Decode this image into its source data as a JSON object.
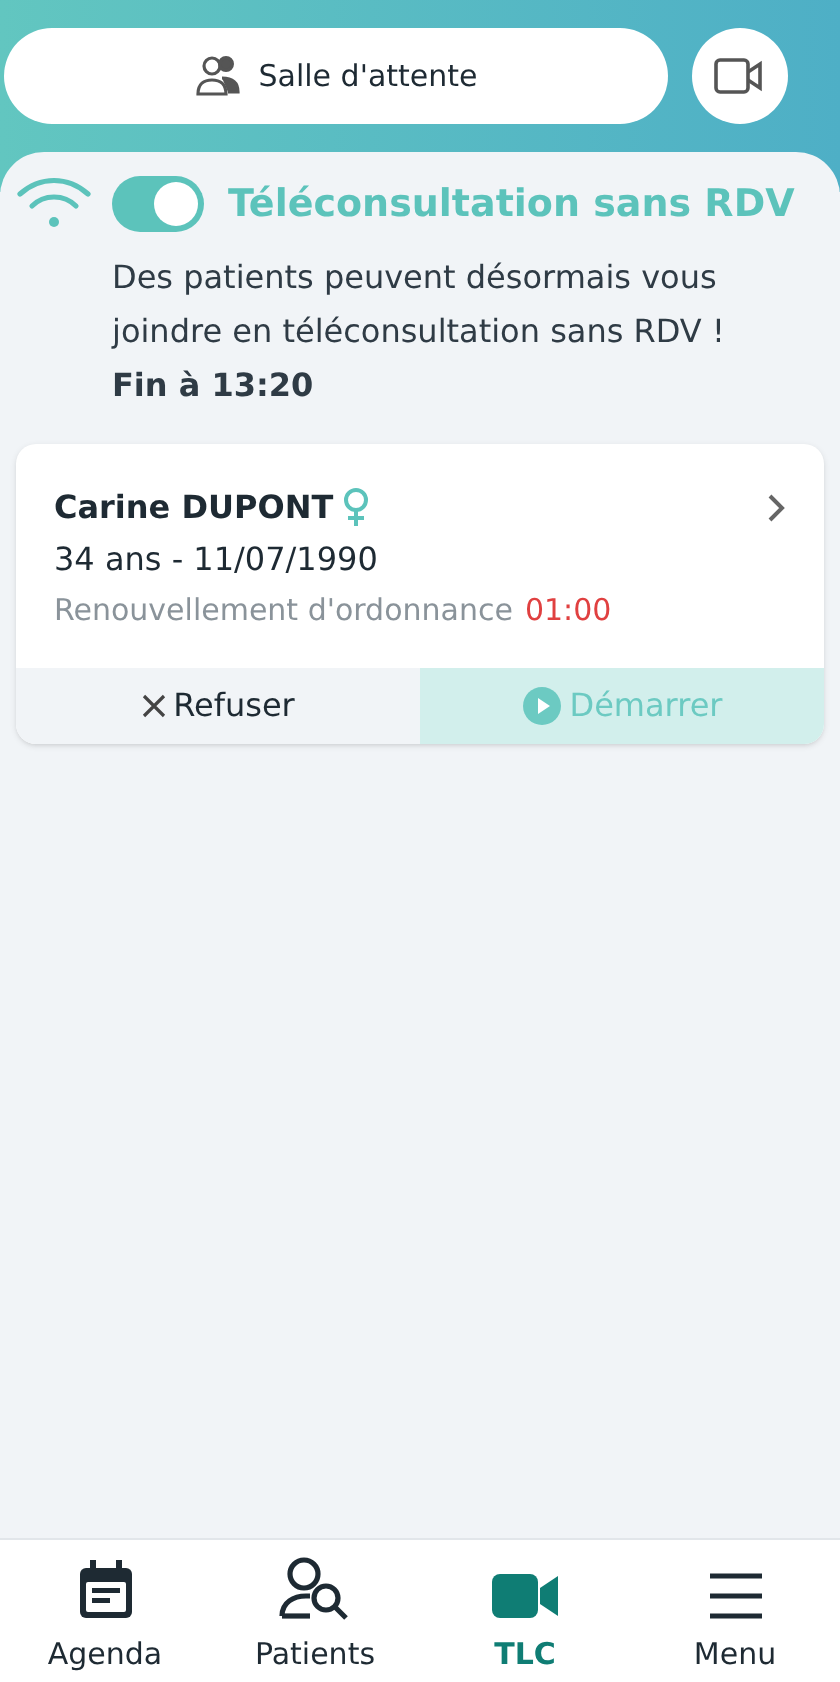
{
  "header": {
    "waiting_room_button": "Salle d'attente"
  },
  "walk_in": {
    "title": "Téléconsultation sans RDV",
    "on": true,
    "message": "Des patients peuvent désormais vous joindre en téléconsultation sans RDV !",
    "end_time": "Fin à 13:20"
  },
  "requests": [
    {
      "name": "Carine DUPONT",
      "age_birthdate": "34 ans - 11/07/1990",
      "reason": "Renouvellement d'ordonnance",
      "timer": "01:00",
      "refuse": "Refuser",
      "start": "Démarrer"
    }
  ],
  "tabs": [
    {
      "label": "Agenda",
      "kind": "calendar",
      "selected": false
    },
    {
      "label": "Patients",
      "kind": "patients",
      "selected": false
    },
    {
      "label": "TLC",
      "kind": "video",
      "selected": true
    },
    {
      "label": "Menu",
      "kind": "menu",
      "selected": false
    }
  ]
}
